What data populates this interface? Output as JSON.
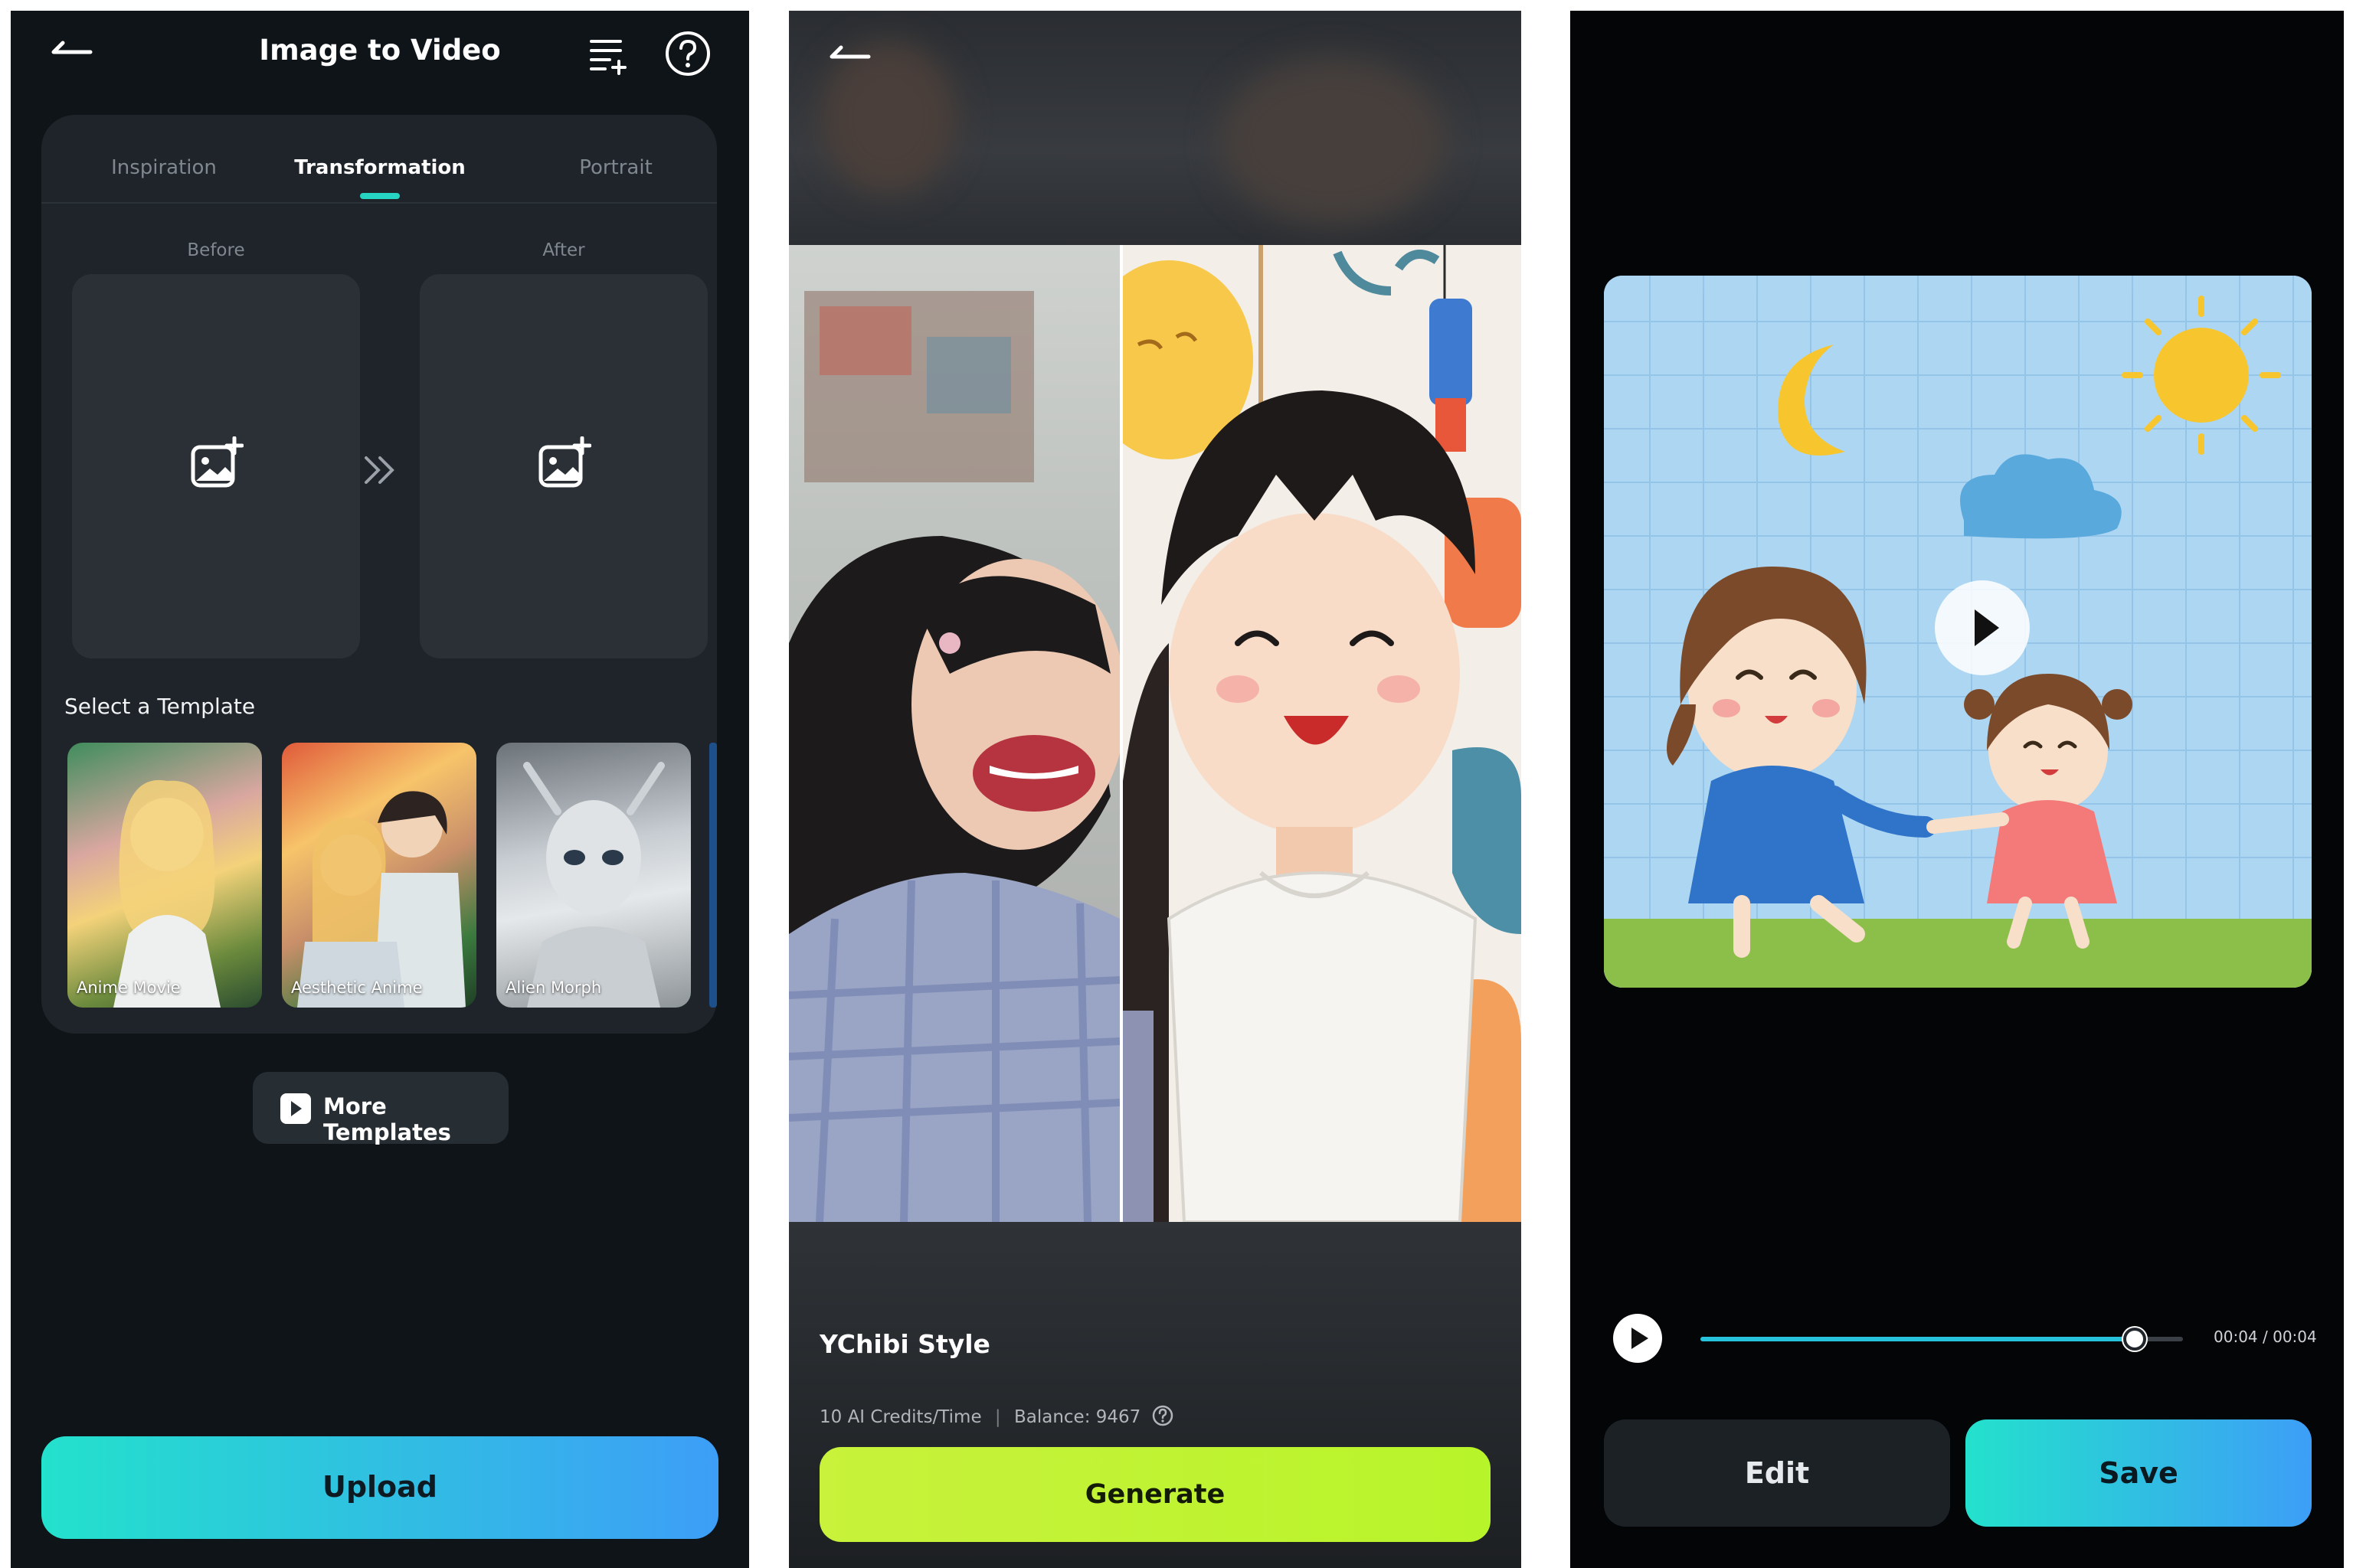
{
  "screen1": {
    "title": "Image to Video",
    "tabs": [
      "Inspiration",
      "Transformation",
      "Portrait"
    ],
    "active_tab": "Transformation",
    "before_label": "Before",
    "after_label": "After",
    "section_title": "Select a Template",
    "templates": [
      "Anime Movie",
      "Aesthetic Anime",
      "Alien Morph"
    ],
    "more_templates_label": "More Templates",
    "upload_label": "Upload",
    "icons": [
      "back-arrow-icon",
      "task-list-icon",
      "help-icon",
      "add-image-icon",
      "double-chevron-right-icon",
      "video-play-icon"
    ]
  },
  "screen2": {
    "style_name": "YChibi Style",
    "credits_text": "10 AI Credits/Time",
    "balance_text": "Balance: 9467",
    "generate_label": "Generate",
    "icons": [
      "back-arrow-icon",
      "help-circle-icon"
    ]
  },
  "screen3": {
    "time_display": "00:04 / 00:04",
    "progress": 0.9,
    "edit_label": "Edit",
    "save_label": "Save",
    "icons": [
      "play-icon"
    ]
  },
  "colors": {
    "accent_teal": "#23e1cc",
    "accent_blue": "#3d9ef7",
    "accent_lime": "#c8f23b",
    "background_dark": "#0f1419"
  }
}
